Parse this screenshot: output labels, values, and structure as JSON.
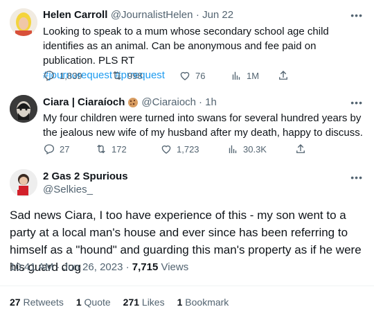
{
  "tweets": [
    {
      "name": "Helen Carroll",
      "handle": "@JournalistHelen",
      "time": "· Jun 22",
      "text": "Looking to speak to a mum whose secondary school age child identifies as an animal. Can be anonymous and fee paid on publication. PLS RT",
      "hashtags": [
        "#journorequest",
        "#prrequest"
      ],
      "stats": {
        "replies": "1,839",
        "retweets": "998",
        "likes": "76",
        "views": "1M"
      }
    },
    {
      "name": "Ciara | Ciaraíoch",
      "handle": "@Ciaraioch",
      "time": "· 1h",
      "text": "My four children were turned into swans for several hundred years by the jealous new wife of my husband after my death, happy to discuss.",
      "stats": {
        "replies": "27",
        "retweets": "172",
        "likes": "1,723",
        "views": "30.3K"
      }
    }
  ],
  "main": {
    "name": "2 Gas 2 Spurious",
    "handle": "@Selkies_",
    "text": "Sad news Ciara, I too have experience of this - my son went to a party at a local man's house and ever since has been referring to himself as a \"hound\" and guarding this man's property as if he were his guard dog",
    "timestamp": "10:41 AM · Jun 26, 2023 · ",
    "views_count": "7,715",
    "views_label": " Views",
    "retweets_count": "27",
    "retweets_label": " Retweets",
    "quotes_count": "1",
    "quotes_label": " Quote",
    "likes_count": "271",
    "likes_label": " Likes",
    "bookmarks_count": "1",
    "bookmarks_label": " Bookmark"
  },
  "more_label": "•••",
  "colors": {
    "accent": "#1d9bf0",
    "muted": "#536471",
    "divider": "#eff3f4"
  }
}
